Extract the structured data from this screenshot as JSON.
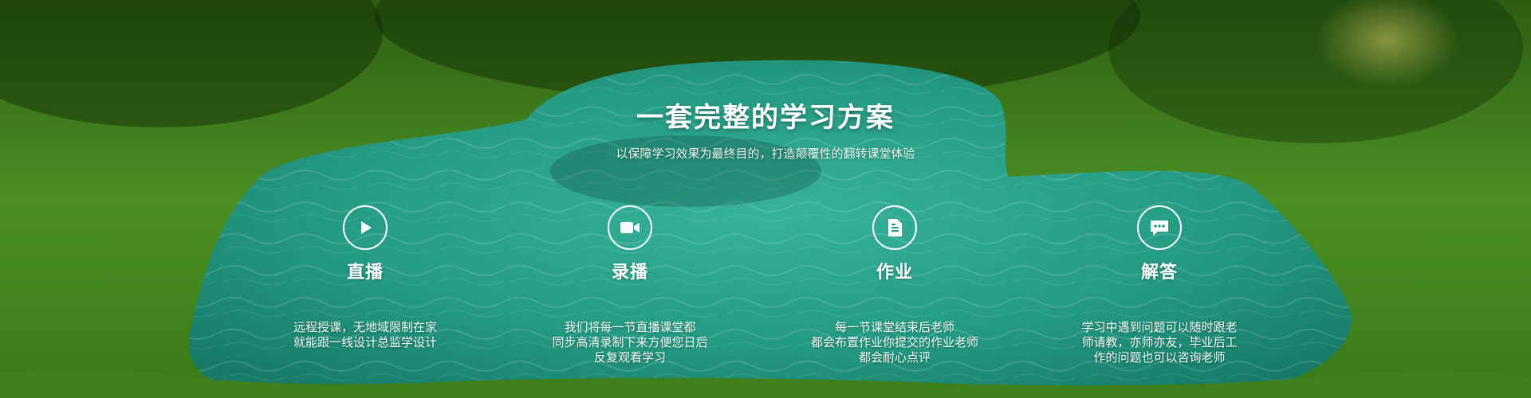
{
  "banner": {
    "title": "一套完整的学习方案",
    "subtitle": "以保障学习效果为最终目的，打造颠覆性的翻转课堂体验"
  },
  "features": [
    {
      "icon": "play-icon",
      "title": "直播",
      "lines": [
        "远程授课，无地域限制在家",
        "就能跟一线设计总监学设计"
      ]
    },
    {
      "icon": "video-camera-icon",
      "title": "录播",
      "lines": [
        "我们将每一节直播课堂都",
        "同步高清录制下来方便您日后",
        "反复观看学习"
      ]
    },
    {
      "icon": "document-icon",
      "title": "作业",
      "lines": [
        "每一节课堂结束后老师",
        "都会布置作业你提交的作业老师",
        "都会耐心点评"
      ]
    },
    {
      "icon": "chat-bubble-icon",
      "title": "解答",
      "lines": [
        "学习中遇到问题可以随时跟老",
        "师请教，亦师亦友，毕业后工",
        "作的问题也可以咨询老师"
      ]
    }
  ],
  "colors": {
    "grass": "#3d7a1c",
    "grass_dark": "#1f4a0d",
    "water": "#2aa38c",
    "water_dark": "#157a69",
    "text": "#ffffff"
  }
}
